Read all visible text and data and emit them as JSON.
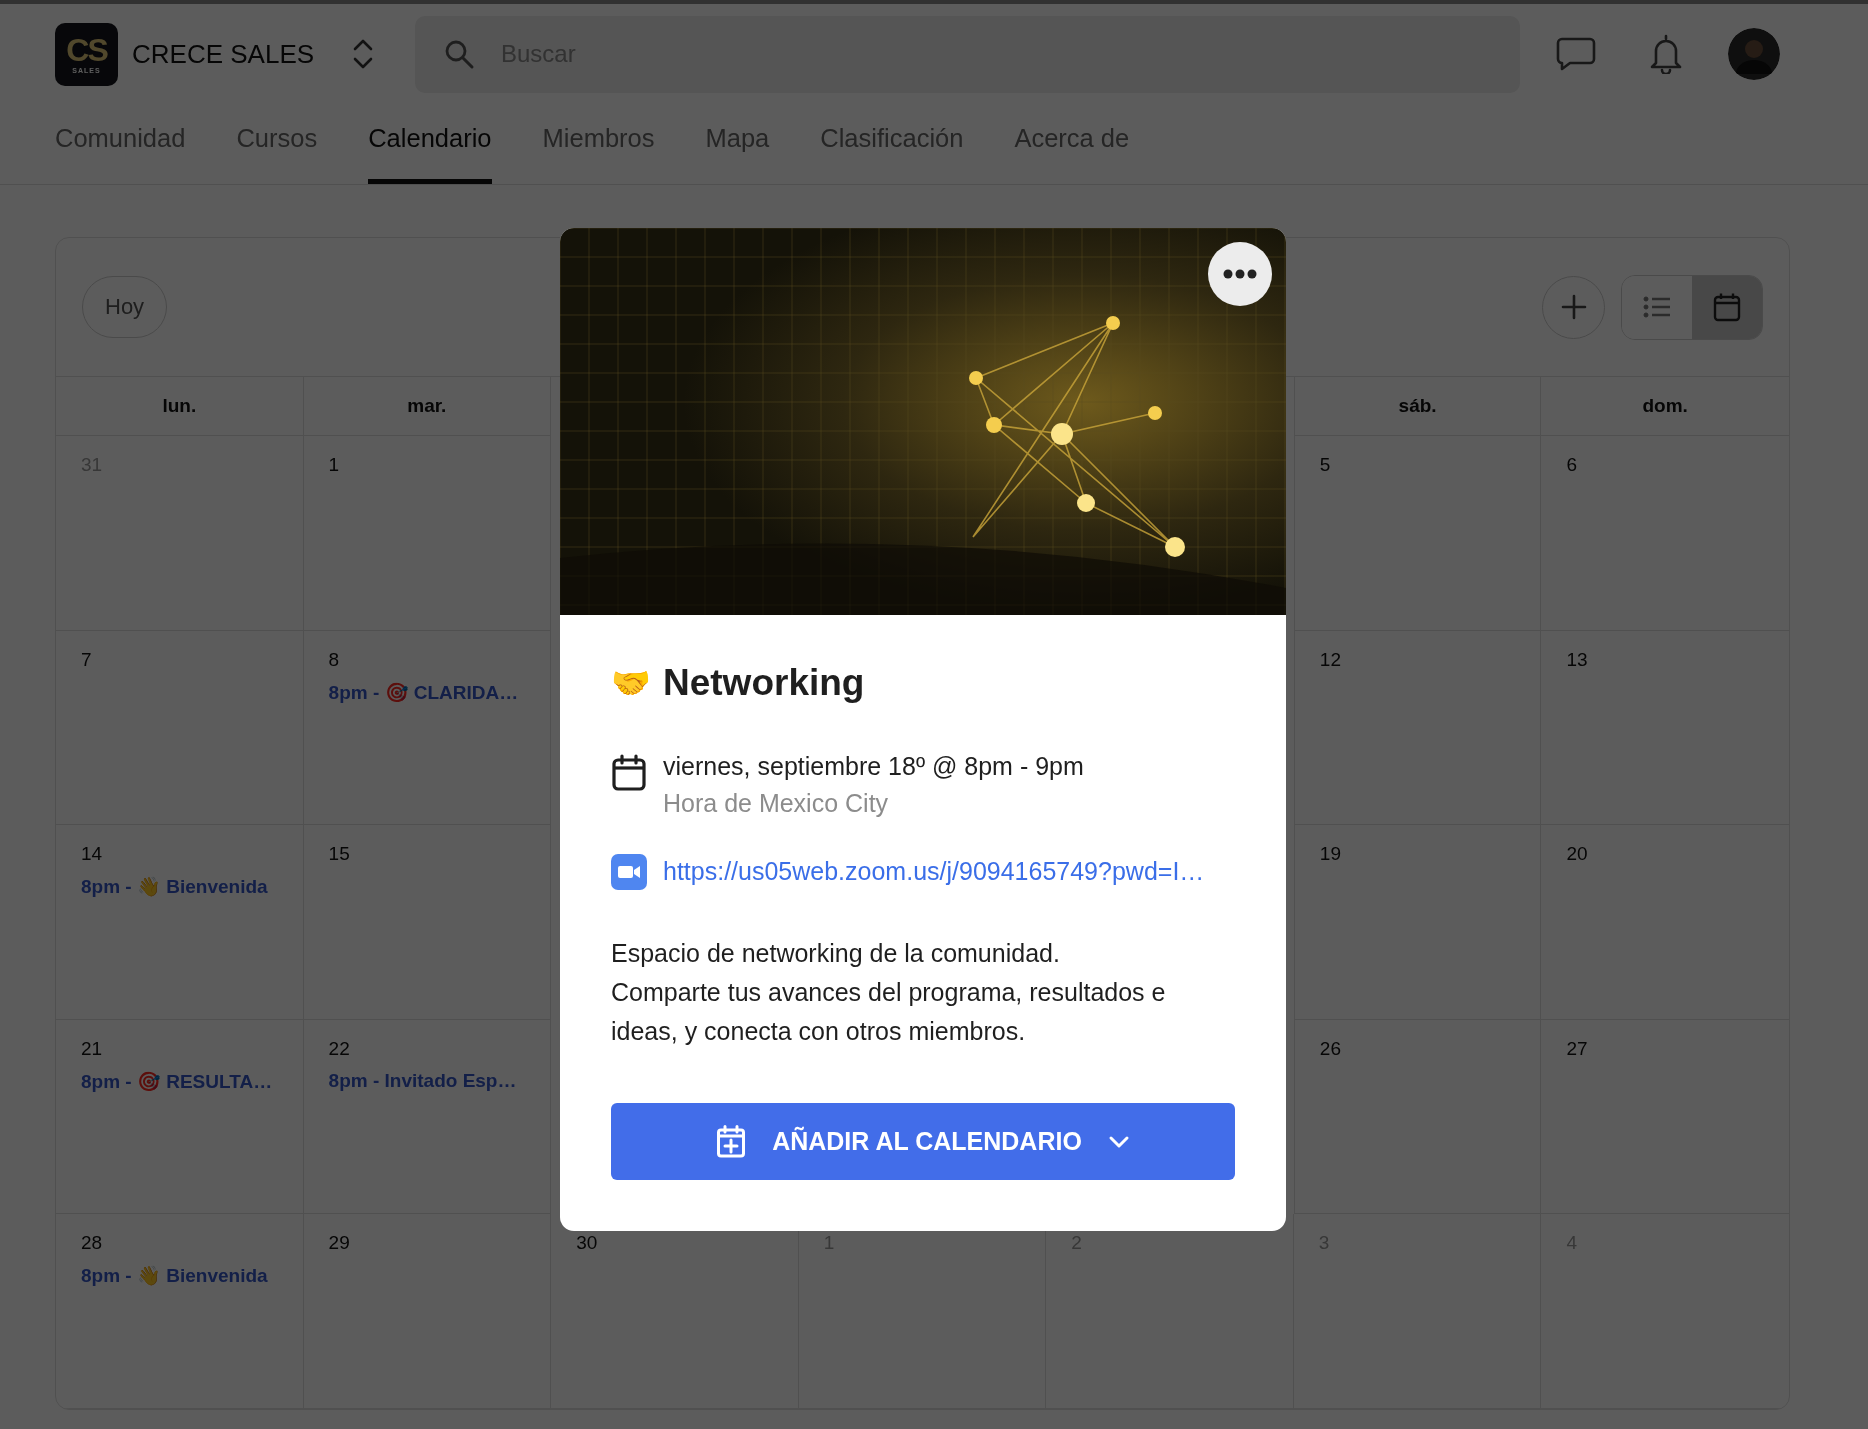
{
  "header": {
    "logo": {
      "text": "CS",
      "subtext": "SALES"
    },
    "community_name": "CRECE SALES",
    "search": {
      "placeholder": "Buscar"
    }
  },
  "tabs": [
    {
      "label": "Comunidad",
      "selected": false
    },
    {
      "label": "Cursos",
      "selected": false
    },
    {
      "label": "Calendario",
      "selected": true
    },
    {
      "label": "Miembros",
      "selected": false
    },
    {
      "label": "Mapa",
      "selected": false
    },
    {
      "label": "Clasificación",
      "selected": false
    },
    {
      "label": "Acerca de",
      "selected": false
    }
  ],
  "calendar": {
    "today_button": "Hoy",
    "views": [
      {
        "kind": "list",
        "selected": false
      },
      {
        "kind": "month",
        "selected": true
      }
    ],
    "weekdays": {
      "left": [
        {
          "label": "lun."
        },
        {
          "label": "mar."
        }
      ],
      "right": [
        {
          "label": "sáb."
        },
        {
          "label": "dom."
        }
      ]
    },
    "weeks": [
      {
        "left": [
          {
            "day": "31",
            "muted": true
          },
          {
            "day": "1",
            "muted": false
          }
        ],
        "right": [
          {
            "day": "5",
            "muted": false
          },
          {
            "day": "6",
            "muted": false
          }
        ]
      },
      {
        "left": [
          {
            "day": "7",
            "muted": false
          },
          {
            "day": "8",
            "muted": false,
            "events": [
              "8pm - 🎯 CLARIDA…"
            ]
          }
        ],
        "right": [
          {
            "day": "12",
            "muted": false
          },
          {
            "day": "13",
            "muted": false
          }
        ]
      },
      {
        "left": [
          {
            "day": "14",
            "muted": false,
            "events": [
              "8pm - 👋 Bienvenida"
            ]
          },
          {
            "day": "15",
            "muted": false
          }
        ],
        "right": [
          {
            "day": "19",
            "muted": false
          },
          {
            "day": "20",
            "muted": false
          }
        ]
      },
      {
        "left": [
          {
            "day": "21",
            "muted": false,
            "events": [
              "8pm - 🎯 RESULTA…"
            ]
          },
          {
            "day": "22",
            "muted": false,
            "events": [
              "8pm - Invitado Esp…"
            ]
          }
        ],
        "right": [
          {
            "day": "26",
            "muted": false
          },
          {
            "day": "27",
            "muted": false
          }
        ]
      },
      {
        "left": [
          {
            "day": "28",
            "muted": false,
            "events": [
              "8pm - 👋 Bienvenida"
            ]
          },
          {
            "day": "29",
            "muted": false
          }
        ],
        "middle": [
          {
            "day": "30",
            "muted": false
          },
          {
            "day": "1",
            "muted": true
          },
          {
            "day": "2",
            "muted": true
          }
        ],
        "right": [
          {
            "day": "3",
            "muted": true
          },
          {
            "day": "4",
            "muted": true
          }
        ]
      }
    ]
  },
  "event_modal": {
    "image": {
      "kind": "picture"
    },
    "emoji": "🤝",
    "title": "Networking",
    "date": "viernes, septiembre 18º @ 8pm - 9pm",
    "timezone": "Hora de Mexico City",
    "link": "https://us05web.zoom.us/j/9094165749?pwd=I…",
    "description": [
      "Espacio de networking de la comunidad.",
      "Comparte tus avances del programa, resultados e ideas, y conecta con otros miembros."
    ],
    "button": "AÑADIR AL CALENDARIO"
  }
}
